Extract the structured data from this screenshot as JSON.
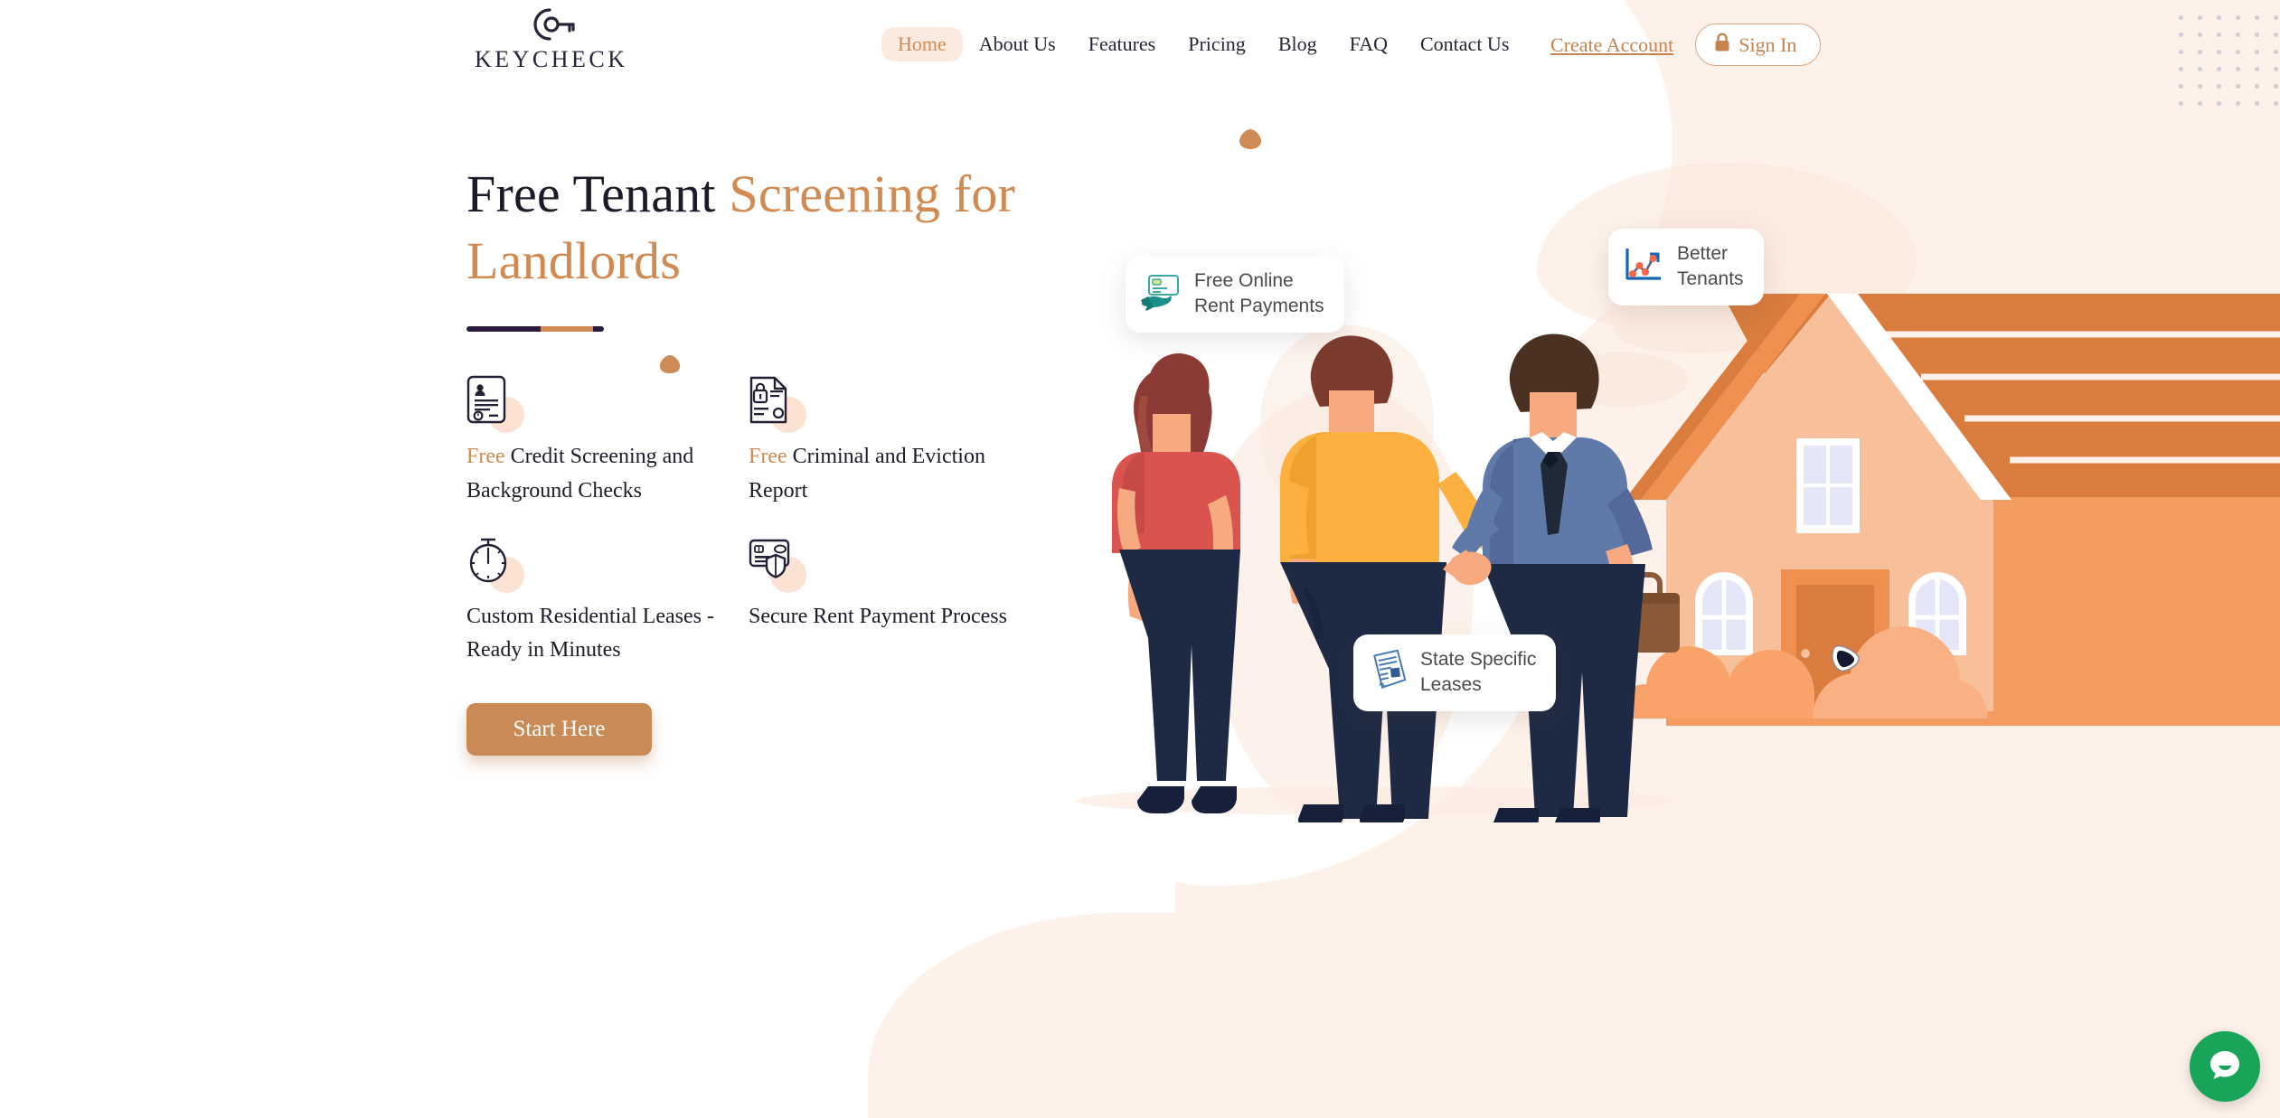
{
  "brand": {
    "name": "KEYCHECK",
    "logo_icon": "key-icon"
  },
  "colors": {
    "accent_orange": "#d08a52",
    "dark_navy": "#1d1b2a",
    "cream_bg": "#fdf1ea",
    "button_bg": "#c98a55",
    "chat_green": "#18a559"
  },
  "nav": {
    "items": [
      {
        "label": "Home",
        "active": true
      },
      {
        "label": "About Us",
        "active": false
      },
      {
        "label": "Features",
        "active": false
      },
      {
        "label": "Pricing",
        "active": false
      },
      {
        "label": "Blog",
        "active": false
      },
      {
        "label": "FAQ",
        "active": false
      },
      {
        "label": "Contact Us",
        "active": false
      }
    ],
    "create_account": "Create Account",
    "sign_in": "Sign In",
    "sign_in_icon": "lock-icon"
  },
  "hero": {
    "headline_part1": "Free Tenant ",
    "headline_part2": "Screening for Landlords",
    "cta": "Start Here"
  },
  "features": [
    {
      "free_prefix": "Free",
      "text": " Credit Screening and Background Checks",
      "icon": "id-document-icon"
    },
    {
      "free_prefix": "Free",
      "text": " Criminal and Eviction Report",
      "icon": "locked-document-icon"
    },
    {
      "free_prefix": "",
      "text": "Custom Residential Leases - Ready in Minutes",
      "icon": "stopwatch-icon"
    },
    {
      "free_prefix": "",
      "text": "Secure Rent Payment Process",
      "icon": "card-shield-icon"
    }
  ],
  "floating_cards": [
    {
      "label": "Free Online\nRent Payments",
      "icon": "hand-card-icon"
    },
    {
      "label": "Better\nTenants",
      "icon": "growth-chart-icon"
    },
    {
      "label": "State Specific\nLeases",
      "icon": "lease-document-icon"
    }
  ],
  "chat": {
    "icon": "chat-bubble-icon"
  }
}
